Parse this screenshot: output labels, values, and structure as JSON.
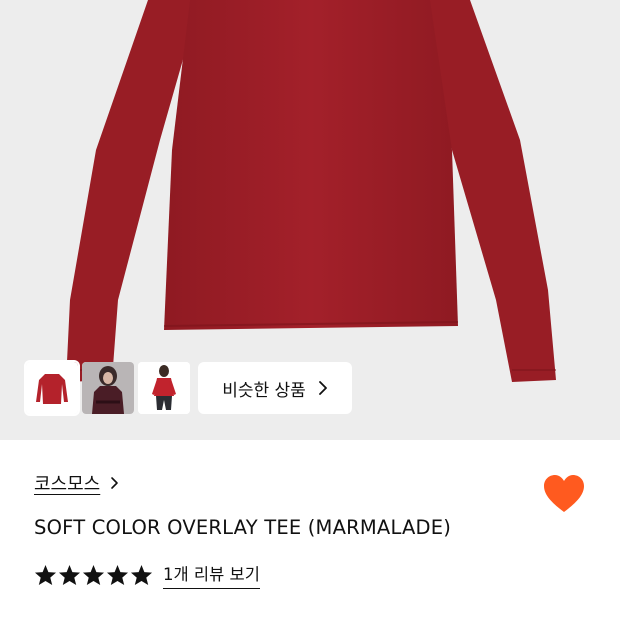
{
  "colors": {
    "hero_bg": "#ededed",
    "garment": "#9e1e26",
    "heart": "#ff5a1f",
    "star": "#111111"
  },
  "gallery": {
    "thumbnails": [
      {
        "icon": "red-tee-flat-thumbnail",
        "selected": true
      },
      {
        "icon": "model-dark-tee-thumbnail",
        "selected": false
      },
      {
        "icon": "model-red-tee-thumbnail",
        "selected": false
      }
    ],
    "similar_label": "비슷한 상품",
    "similar_icon": "chevron-right-icon"
  },
  "product": {
    "brand": "코스모스",
    "brand_icon": "chevron-right-icon",
    "title": "SOFT COLOR OVERLAY TEE (MARMALADE)",
    "rating_stars": 5,
    "review_link": "1개 리뷰 보기",
    "wishlist_icon": "heart-icon",
    "wishlisted": true
  }
}
